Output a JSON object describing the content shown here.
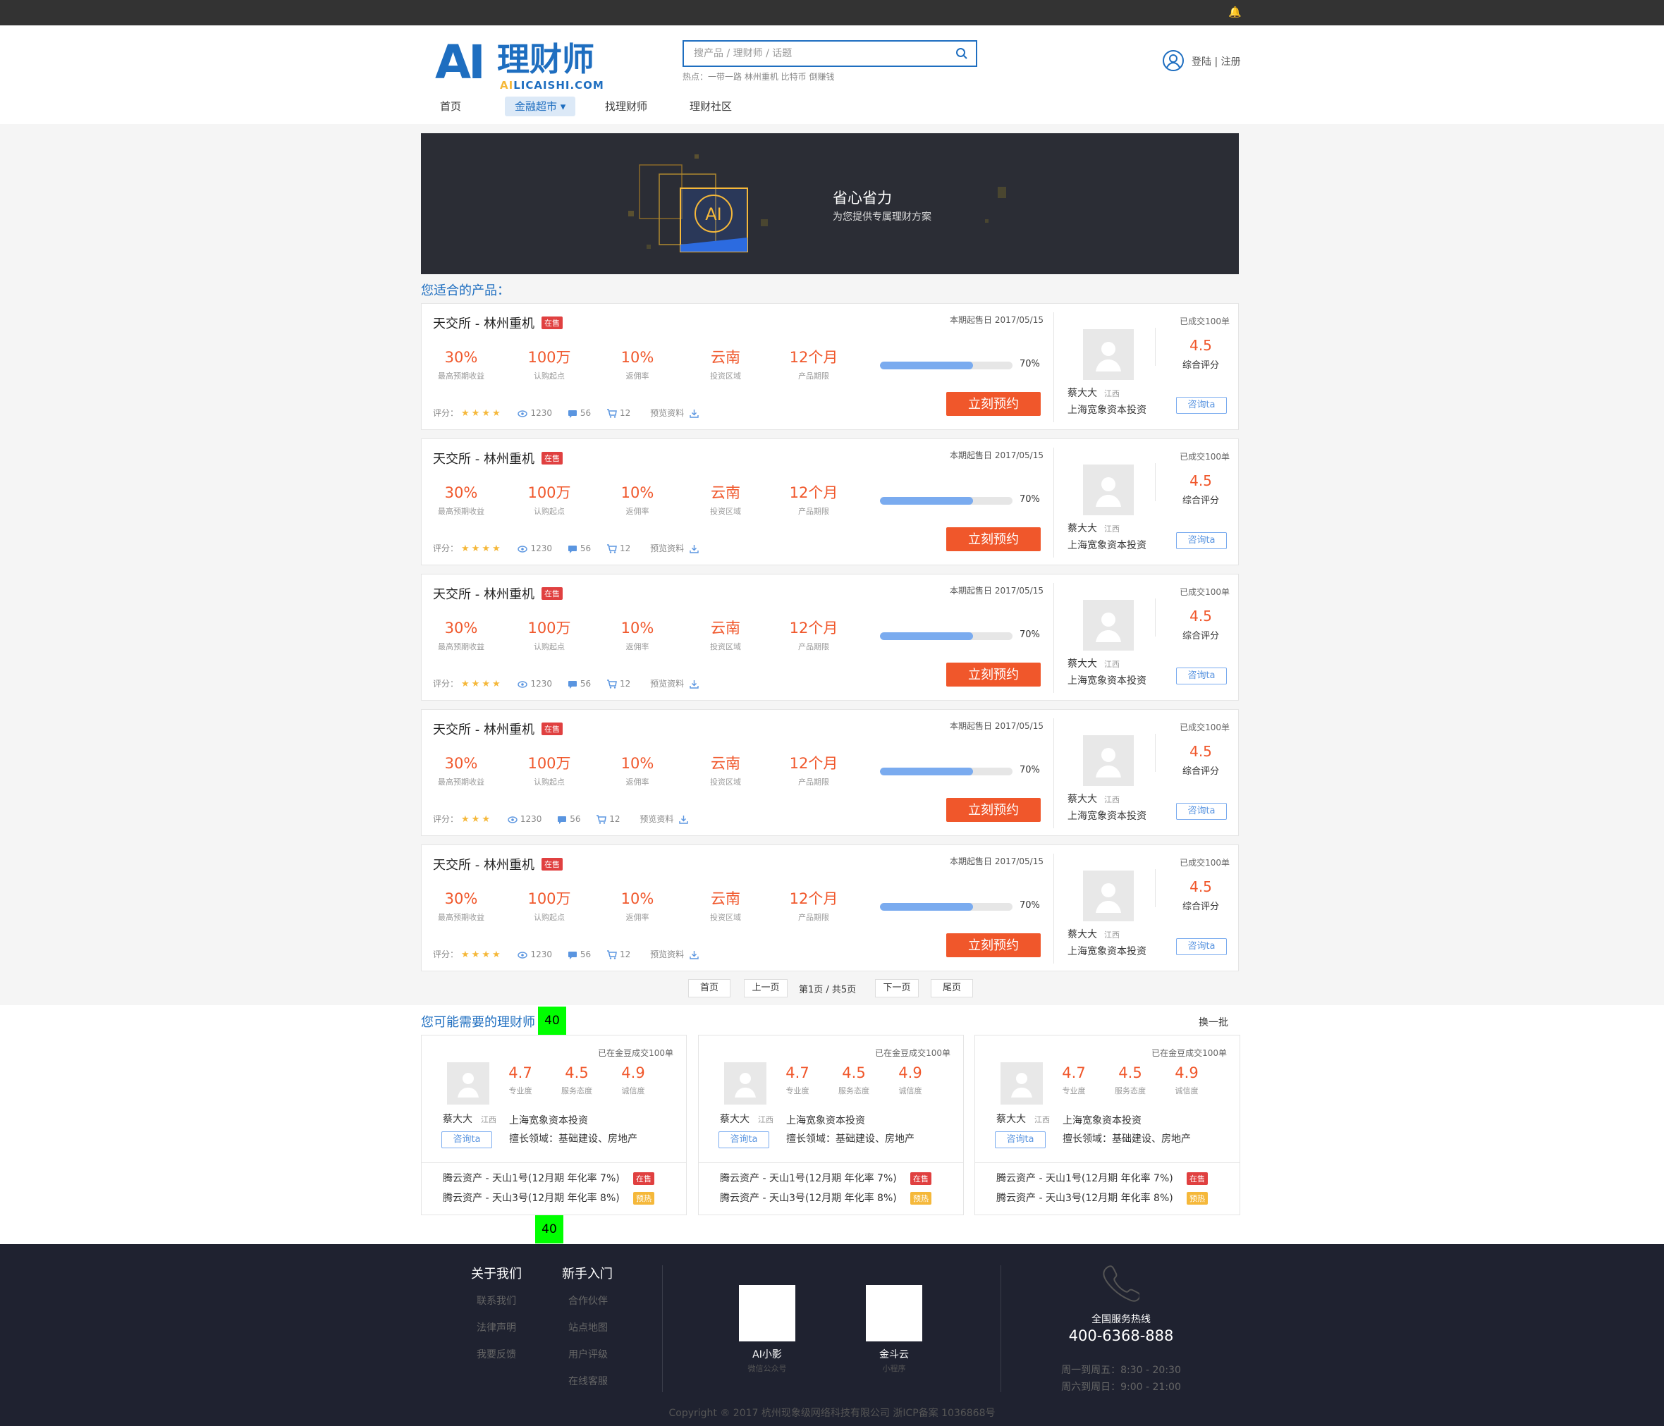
{
  "header": {
    "search_placeholder": "搜产品 / 理财师 / 话题",
    "hot_label": "热点：一带一路 林州重机 比特币 倒赚钱",
    "login_text": "登陆 | 注册",
    "logo_ai": "AI",
    "logo_cn": "理财师",
    "logo_url_hl": "AI",
    "logo_url_rest": "LICAISHI.COM"
  },
  "nav": [
    "首页",
    "金融超市 ▾",
    "找理财师",
    "理财社区"
  ],
  "banner": {
    "title": "省心省力",
    "subtitle": "为您提供专属理财方案",
    "icon_text": "AI"
  },
  "products_title": "您适合的产品：",
  "products": [
    {
      "name": "天交所 - 林州重机",
      "tag": "在售",
      "date": "本期起售日 2017/05/15",
      "stats": [
        {
          "v": "30%",
          "l": "最高预期收益"
        },
        {
          "v": "100万",
          "l": "认购起点"
        },
        {
          "v": "10%",
          "l": "返佣率"
        },
        {
          "v": "云南",
          "l": "投资区域"
        },
        {
          "v": "12个月",
          "l": "产品期限"
        }
      ],
      "progress": 0.7,
      "progress_label": "70%",
      "buy": "立刻预约",
      "rating_label": "评分：",
      "stars": "★★★★",
      "views": "1230",
      "comments": "56",
      "carts": "12",
      "docs": "预览资料",
      "adv": {
        "done": "已成交100单",
        "score": "4.5",
        "score_label": "综合评分",
        "name": "蔡大大",
        "region": "江西",
        "company": "上海宽象资本投资",
        "consult": "咨询ta"
      }
    },
    {
      "name": "天交所 - 林州重机",
      "tag": "在售",
      "date": "本期起售日 2017/05/15",
      "stats": [
        {
          "v": "30%",
          "l": "最高预期收益"
        },
        {
          "v": "100万",
          "l": "认购起点"
        },
        {
          "v": "10%",
          "l": "返佣率"
        },
        {
          "v": "云南",
          "l": "投资区域"
        },
        {
          "v": "12个月",
          "l": "产品期限"
        }
      ],
      "progress": 0.7,
      "progress_label": "70%",
      "buy": "立刻预约",
      "rating_label": "评分：",
      "stars": "★★★★",
      "views": "1230",
      "comments": "56",
      "carts": "12",
      "docs": "预览资料",
      "adv": {
        "done": "已成交100单",
        "score": "4.5",
        "score_label": "综合评分",
        "name": "蔡大大",
        "region": "江西",
        "company": "上海宽象资本投资",
        "consult": "咨询ta"
      }
    },
    {
      "name": "天交所 - 林州重机",
      "tag": "在售",
      "date": "本期起售日 2017/05/15",
      "stats": [
        {
          "v": "30%",
          "l": "最高预期收益"
        },
        {
          "v": "100万",
          "l": "认购起点"
        },
        {
          "v": "10%",
          "l": "返佣率"
        },
        {
          "v": "云南",
          "l": "投资区域"
        },
        {
          "v": "12个月",
          "l": "产品期限"
        }
      ],
      "progress": 0.7,
      "progress_label": "70%",
      "buy": "立刻预约",
      "rating_label": "评分：",
      "stars": "★★★★",
      "views": "1230",
      "comments": "56",
      "carts": "12",
      "docs": "预览资料",
      "adv": {
        "done": "已成交100单",
        "score": "4.5",
        "score_label": "综合评分",
        "name": "蔡大大",
        "region": "江西",
        "company": "上海宽象资本投资",
        "consult": "咨询ta"
      }
    },
    {
      "name": "天交所 - 林州重机",
      "tag": "在售",
      "date": "本期起售日 2017/05/15",
      "stats": [
        {
          "v": "30%",
          "l": "最高预期收益"
        },
        {
          "v": "100万",
          "l": "认购起点"
        },
        {
          "v": "10%",
          "l": "返佣率"
        },
        {
          "v": "云南",
          "l": "投资区域"
        },
        {
          "v": "12个月",
          "l": "产品期限"
        }
      ],
      "progress": 0.7,
      "progress_label": "70%",
      "buy": "立刻预约",
      "rating_label": "评分：",
      "stars": "★★★",
      "views": "1230",
      "comments": "56",
      "carts": "12",
      "docs": "预览资料",
      "adv": {
        "done": "已成交100单",
        "score": "4.5",
        "score_label": "综合评分",
        "name": "蔡大大",
        "region": "江西",
        "company": "上海宽象资本投资",
        "consult": "咨询ta"
      }
    },
    {
      "name": "天交所 - 林州重机",
      "tag": "在售",
      "date": "本期起售日 2017/05/15",
      "stats": [
        {
          "v": "30%",
          "l": "最高预期收益"
        },
        {
          "v": "100万",
          "l": "认购起点"
        },
        {
          "v": "10%",
          "l": "返佣率"
        },
        {
          "v": "云南",
          "l": "投资区域"
        },
        {
          "v": "12个月",
          "l": "产品期限"
        }
      ],
      "progress": 0.7,
      "progress_label": "70%",
      "buy": "立刻预约",
      "rating_label": "评分：",
      "stars": "★★★★",
      "views": "1230",
      "comments": "56",
      "carts": "12",
      "docs": "预览资料",
      "adv": {
        "done": "已成交100单",
        "score": "4.5",
        "score_label": "综合评分",
        "name": "蔡大大",
        "region": "江西",
        "company": "上海宽象资本投资",
        "consult": "咨询ta"
      }
    }
  ],
  "pager": {
    "first": "首页",
    "prev": "上一页",
    "info": "第1页 / 共5页",
    "next": "下一页",
    "last": "尾页"
  },
  "advisors_title": "您可能需要的理财师",
  "spacing_markers": [
    "40",
    "40"
  ],
  "refresh": "换一批",
  "advisors": [
    {
      "done": "已在金豆成交100单",
      "scores": [
        {
          "v": "4.7",
          "l": "专业度"
        },
        {
          "v": "4.5",
          "l": "服务态度"
        },
        {
          "v": "4.9",
          "l": "诚信度"
        }
      ],
      "name": "蔡大大",
      "region": "江西",
      "company": "上海宽象资本投资",
      "skill": "擅长领域：基础建设、房地产",
      "consult": "咨询ta",
      "products": [
        {
          "name": "腾云资产 - 天山1号(12月期 年化率 7%)",
          "tag": "在售"
        },
        {
          "name": "腾云资产 - 天山3号(12月期 年化率 8%)",
          "tag": "预热"
        }
      ]
    },
    {
      "done": "已在金豆成交100单",
      "scores": [
        {
          "v": "4.7",
          "l": "专业度"
        },
        {
          "v": "4.5",
          "l": "服务态度"
        },
        {
          "v": "4.9",
          "l": "诚信度"
        }
      ],
      "name": "蔡大大",
      "region": "江西",
      "company": "上海宽象资本投资",
      "skill": "擅长领域：基础建设、房地产",
      "consult": "咨询ta",
      "products": [
        {
          "name": "腾云资产 - 天山1号(12月期 年化率 7%)",
          "tag": "在售"
        },
        {
          "name": "腾云资产 - 天山3号(12月期 年化率 8%)",
          "tag": "预热"
        }
      ]
    },
    {
      "done": "已在金豆成交100单",
      "scores": [
        {
          "v": "4.7",
          "l": "专业度"
        },
        {
          "v": "4.5",
          "l": "服务态度"
        },
        {
          "v": "4.9",
          "l": "诚信度"
        }
      ],
      "name": "蔡大大",
      "region": "江西",
      "company": "上海宽象资本投资",
      "skill": "擅长领域：基础建设、房地产",
      "consult": "咨询ta",
      "products": [
        {
          "name": "腾云资产 - 天山1号(12月期 年化率 7%)",
          "tag": "在售"
        },
        {
          "name": "腾云资产 - 天山3号(12月期 年化率 8%)",
          "tag": "预热"
        }
      ]
    }
  ],
  "footer": {
    "about": {
      "title": "关于我们",
      "links": [
        "联系我们",
        "法律声明",
        "我要反馈"
      ]
    },
    "newbie": {
      "title": "新手入门",
      "links": [
        "合作伙伴",
        "站点地图",
        "用户评级",
        "在线客服"
      ]
    },
    "qr": [
      {
        "title": "AI小影",
        "sub": "微信公众号"
      },
      {
        "title": "金斗云",
        "sub": "小程序"
      }
    ],
    "hotline_label": "全国服务热线",
    "hotline": "400-6368-888",
    "hours": [
      "周一到周五：8:30 - 20:30",
      "周六到周日：9:00 - 21:00"
    ],
    "copyright": "Copyright ® 2017 杭州现象级网络科技有限公司 浙ICP备案 1036868号"
  },
  "colors": {
    "brand": "#1e6ec0",
    "accent": "#f0572b",
    "sale_tag": "#e04040",
    "hot_tag": "#f5b83a",
    "footer_bg": "#1f2230",
    "marker": "#00ff00"
  }
}
